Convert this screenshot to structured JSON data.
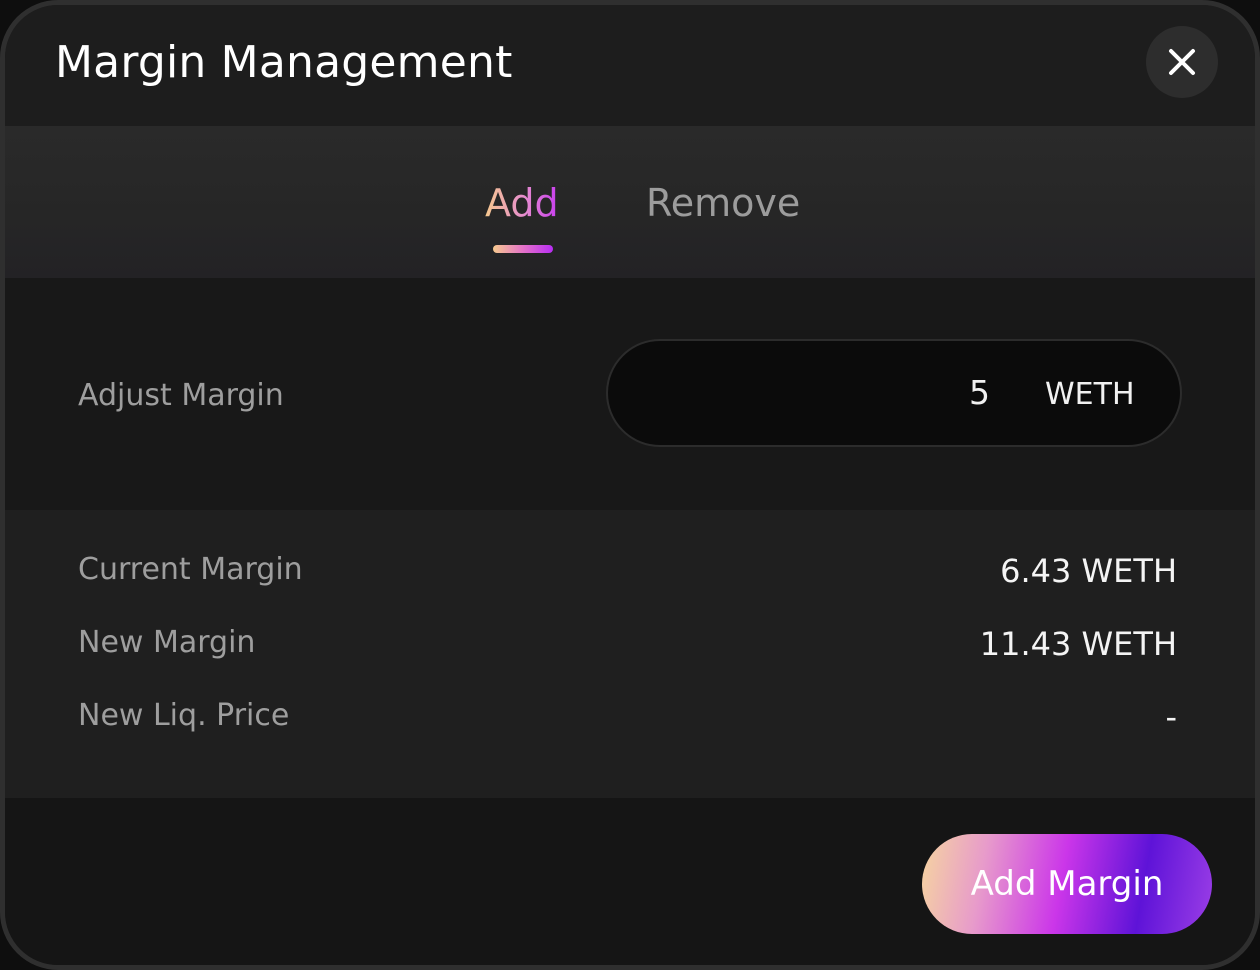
{
  "modal": {
    "title": "Margin Management"
  },
  "tabs": [
    {
      "label": "Add",
      "active": true
    },
    {
      "label": "Remove",
      "active": false
    }
  ],
  "adjust": {
    "label": "Adjust Margin",
    "value": "5",
    "unit": "WETH"
  },
  "details": [
    {
      "label": "Current Margin",
      "value": "6.43 WETH"
    },
    {
      "label": "New Margin",
      "value": "11.43 WETH"
    },
    {
      "label": "New Liq. Price",
      "value": "-"
    }
  ],
  "action": {
    "button_label": "Add Margin"
  },
  "icons": {
    "close": "close-icon"
  },
  "colors": {
    "background": "#1b1b1b",
    "accent_start": "#f6c98e",
    "accent_mid": "#cb36e9",
    "accent_end": "#5e13d8",
    "muted_text": "#9e9e9e"
  }
}
